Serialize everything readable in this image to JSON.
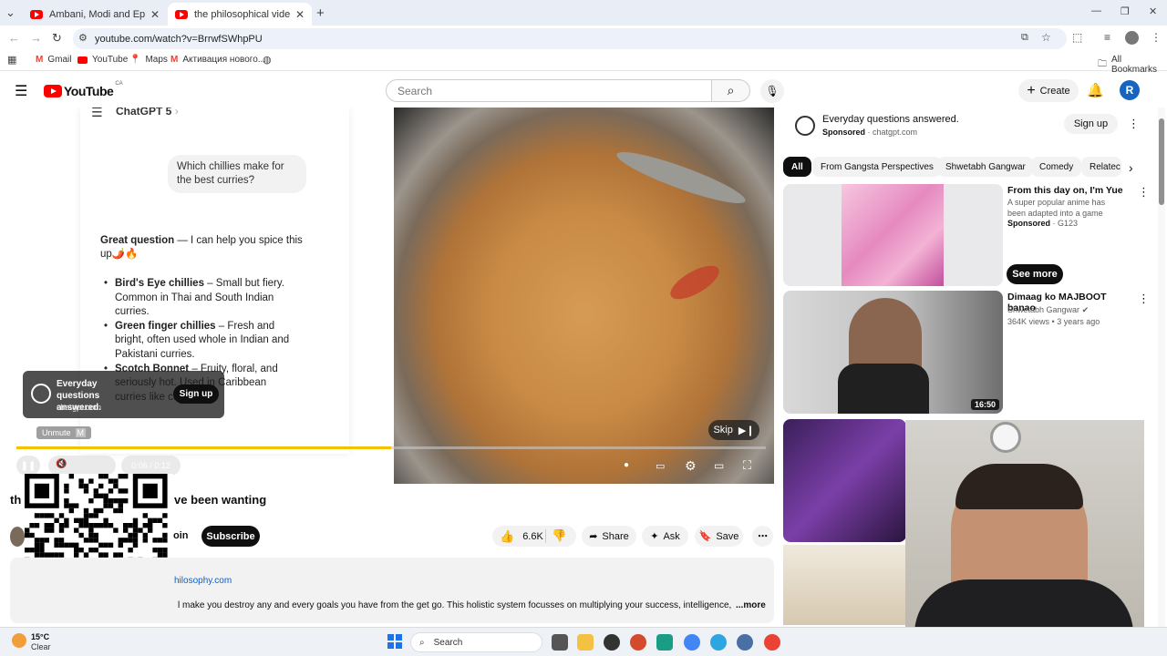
{
  "browser": {
    "tabs": [
      {
        "title": "Ambani, Modi and Epstein | Le"
      },
      {
        "title": "the philosophical video you ha"
      }
    ],
    "url": "youtube.com/watch?v=BrrwfSWhpPU",
    "bookmarks": [
      "Gmail",
      "YouTube",
      "Maps",
      "Активация нового..."
    ],
    "all_bookmarks": "All Bookmarks"
  },
  "youtube": {
    "logo_text": "YouTube",
    "region": "CA",
    "search_placeholder": "Search",
    "create_label": "Create",
    "avatar_letter": "R"
  },
  "video": {
    "chat_header": "ChatGPT 5",
    "chat_question": "Which chillies make for the best curries?",
    "chat_intro_bold": "Great question",
    "chat_intro_rest": " — I can help you spice this up🌶️🔥",
    "chat_items": [
      {
        "name": "Bird's Eye chillies",
        "text": " – Small but fiery. Common in Thai and South Indian curries."
      },
      {
        "name": "Green finger chillies",
        "text": " – Fresh and bright, often used whole in Indian and Pakistani curries."
      },
      {
        "name": "Scotch Bonnet",
        "text": " – Fruity, floral, and seriously hot. Used in Caribbean curries like curry goat."
      }
    ],
    "ad_overlay_title": "Everyday questions answered.",
    "ad_overlay_domain": "chatgpt.com",
    "ad_overlay_signup": "Sign up",
    "unmute_label": "Unmute",
    "unmute_key": "M",
    "time": "0:06 / 0:12",
    "skip_label": "Skip",
    "progress": 0.5,
    "title_start": "th",
    "title_end": "ve been wanting"
  },
  "actions": {
    "join": "oin",
    "subscribe": "Subscribe",
    "likes": "6.6K",
    "share": "Share",
    "ask": "Ask",
    "save": "Save"
  },
  "description": {
    "link": "hilosophy.com",
    "text": "l make you destroy any and every goals you have from the get go. This holistic system focusses on multiplying your success, intelligence, and good l",
    "more": "...more"
  },
  "sidebar": {
    "sponsor": {
      "title": "Everyday questions answered.",
      "label": "Sponsored",
      "domain": "chatgpt.com",
      "signup": "Sign up"
    },
    "chips": [
      "All",
      "From Gangsta Perspectives",
      "Shwetabh Gangwar",
      "Comedy",
      "Relatec"
    ],
    "items": [
      {
        "title": "From this day on, I'm Yue",
        "desc": "A super popular anime has been adapted into a game",
        "sponsored": "Sponsored",
        "channel": "G123",
        "cta": "See more"
      },
      {
        "title": "Dimaag ko MAJBOOT banao",
        "channel": "Shwetabh Gangwar",
        "views": "364K views",
        "age": "3 years ago",
        "duration": "16:50"
      }
    ]
  },
  "taskbar": {
    "weather_temp": "15°C",
    "weather_desc": "Clear",
    "search_label": "Search"
  },
  "colors": {
    "accent": "#ff0000",
    "progress": "#f2c200",
    "link": "#065fd4"
  }
}
